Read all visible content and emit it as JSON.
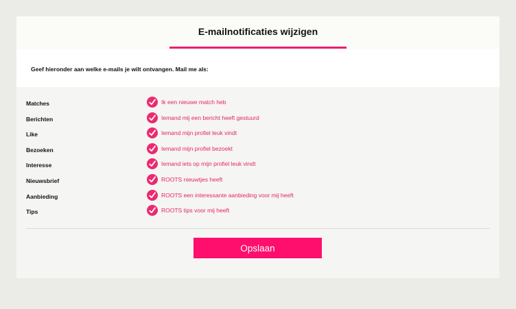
{
  "page": {
    "title": "E-mailnotificaties wijzigen",
    "intro": "Geef hieronder aan welke e-mails je wilt ontvangen. Mail me als:"
  },
  "preferences": [
    {
      "label": "Matches",
      "option": "Ik een nieuwe match heb",
      "checked": true
    },
    {
      "label": "Berichten",
      "option": "Iemand mij een bericht heeft gestuurd",
      "checked": true
    },
    {
      "label": "Like",
      "option": "Iemand mijn profiel leuk vindt",
      "checked": true
    },
    {
      "label": "Bezoeken",
      "option": "Iemand mijn profiel bezoekt",
      "checked": true
    },
    {
      "label": "Interesse",
      "option": "Iemand iets op mijn profiel leuk vindt",
      "checked": true
    },
    {
      "label": "Nieuwsbrief",
      "option": "ROOTS nieuwtjes heeft",
      "checked": true
    },
    {
      "label": "Aanbieding",
      "option": "ROOTS een interessante aanbieding voor mij heeft",
      "checked": true
    },
    {
      "label": "Tips",
      "option": "ROOTS tips voor mij heeft",
      "checked": true
    }
  ],
  "actions": {
    "save_label": "Opslaan"
  },
  "colors": {
    "accent": "#ee1d6f",
    "button": "#fe0e6d",
    "background": "#ebebe7"
  },
  "icons": {
    "check": "checkmark-circle-icon"
  }
}
